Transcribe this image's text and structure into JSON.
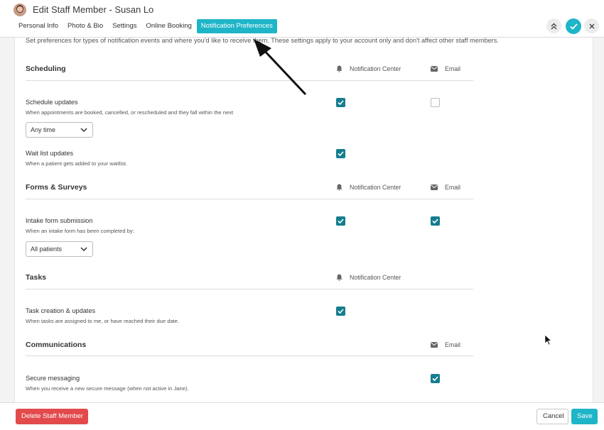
{
  "header": {
    "title": "Edit Staff Member - Susan Lo",
    "tabs": [
      {
        "label": "Personal Info"
      },
      {
        "label": "Photo & Bio"
      },
      {
        "label": "Settings"
      },
      {
        "label": "Online Booking"
      },
      {
        "label": "Notification Preferences"
      }
    ],
    "active_tab": "Notification Preferences"
  },
  "intro_text": "Set preferences for types of notification events and where you'd like to receive them. These settings apply to your account only and don't affect other staff members.",
  "columns": {
    "notification_center": "Notification Center",
    "email": "Email"
  },
  "sections": {
    "scheduling": {
      "title": "Scheduling",
      "schedule_updates": {
        "title": "Schedule updates",
        "description": "When appointments are booked, cancelled, or rescheduled and they fall within the next",
        "select_value": "Any time",
        "notification_center": true,
        "email": false
      },
      "wait_list": {
        "title": "Wait list updates",
        "description": "When a patient gets added to your waitlist.",
        "notification_center": true
      }
    },
    "forms": {
      "title": "Forms & Surveys",
      "intake": {
        "title": "Intake form submission",
        "description": "When an intake form has been completed by:",
        "select_value": "All patients",
        "notification_center": true,
        "email": true
      }
    },
    "tasks": {
      "title": "Tasks",
      "task_updates": {
        "title": "Task creation & updates",
        "description": "When tasks are assigned to me, or have reached their due date.",
        "notification_center": true
      }
    },
    "communications": {
      "title": "Communications",
      "secure_messaging": {
        "title": "Secure messaging",
        "description": "When you receive a new secure message (when not active in Jane).",
        "email": true
      }
    }
  },
  "footer": {
    "delete_label": "Delete Staff Member",
    "cancel_label": "Cancel",
    "save_label": "Save"
  },
  "colors": {
    "accent": "#1fb5c8",
    "checkbox_checked": "#157d8f",
    "danger": "#e24a4c"
  },
  "icons": {
    "notification_center": "bell-icon",
    "email": "envelope-icon",
    "collapse": "double-chevron-up-icon",
    "confirm": "check-icon",
    "close": "close-icon"
  }
}
